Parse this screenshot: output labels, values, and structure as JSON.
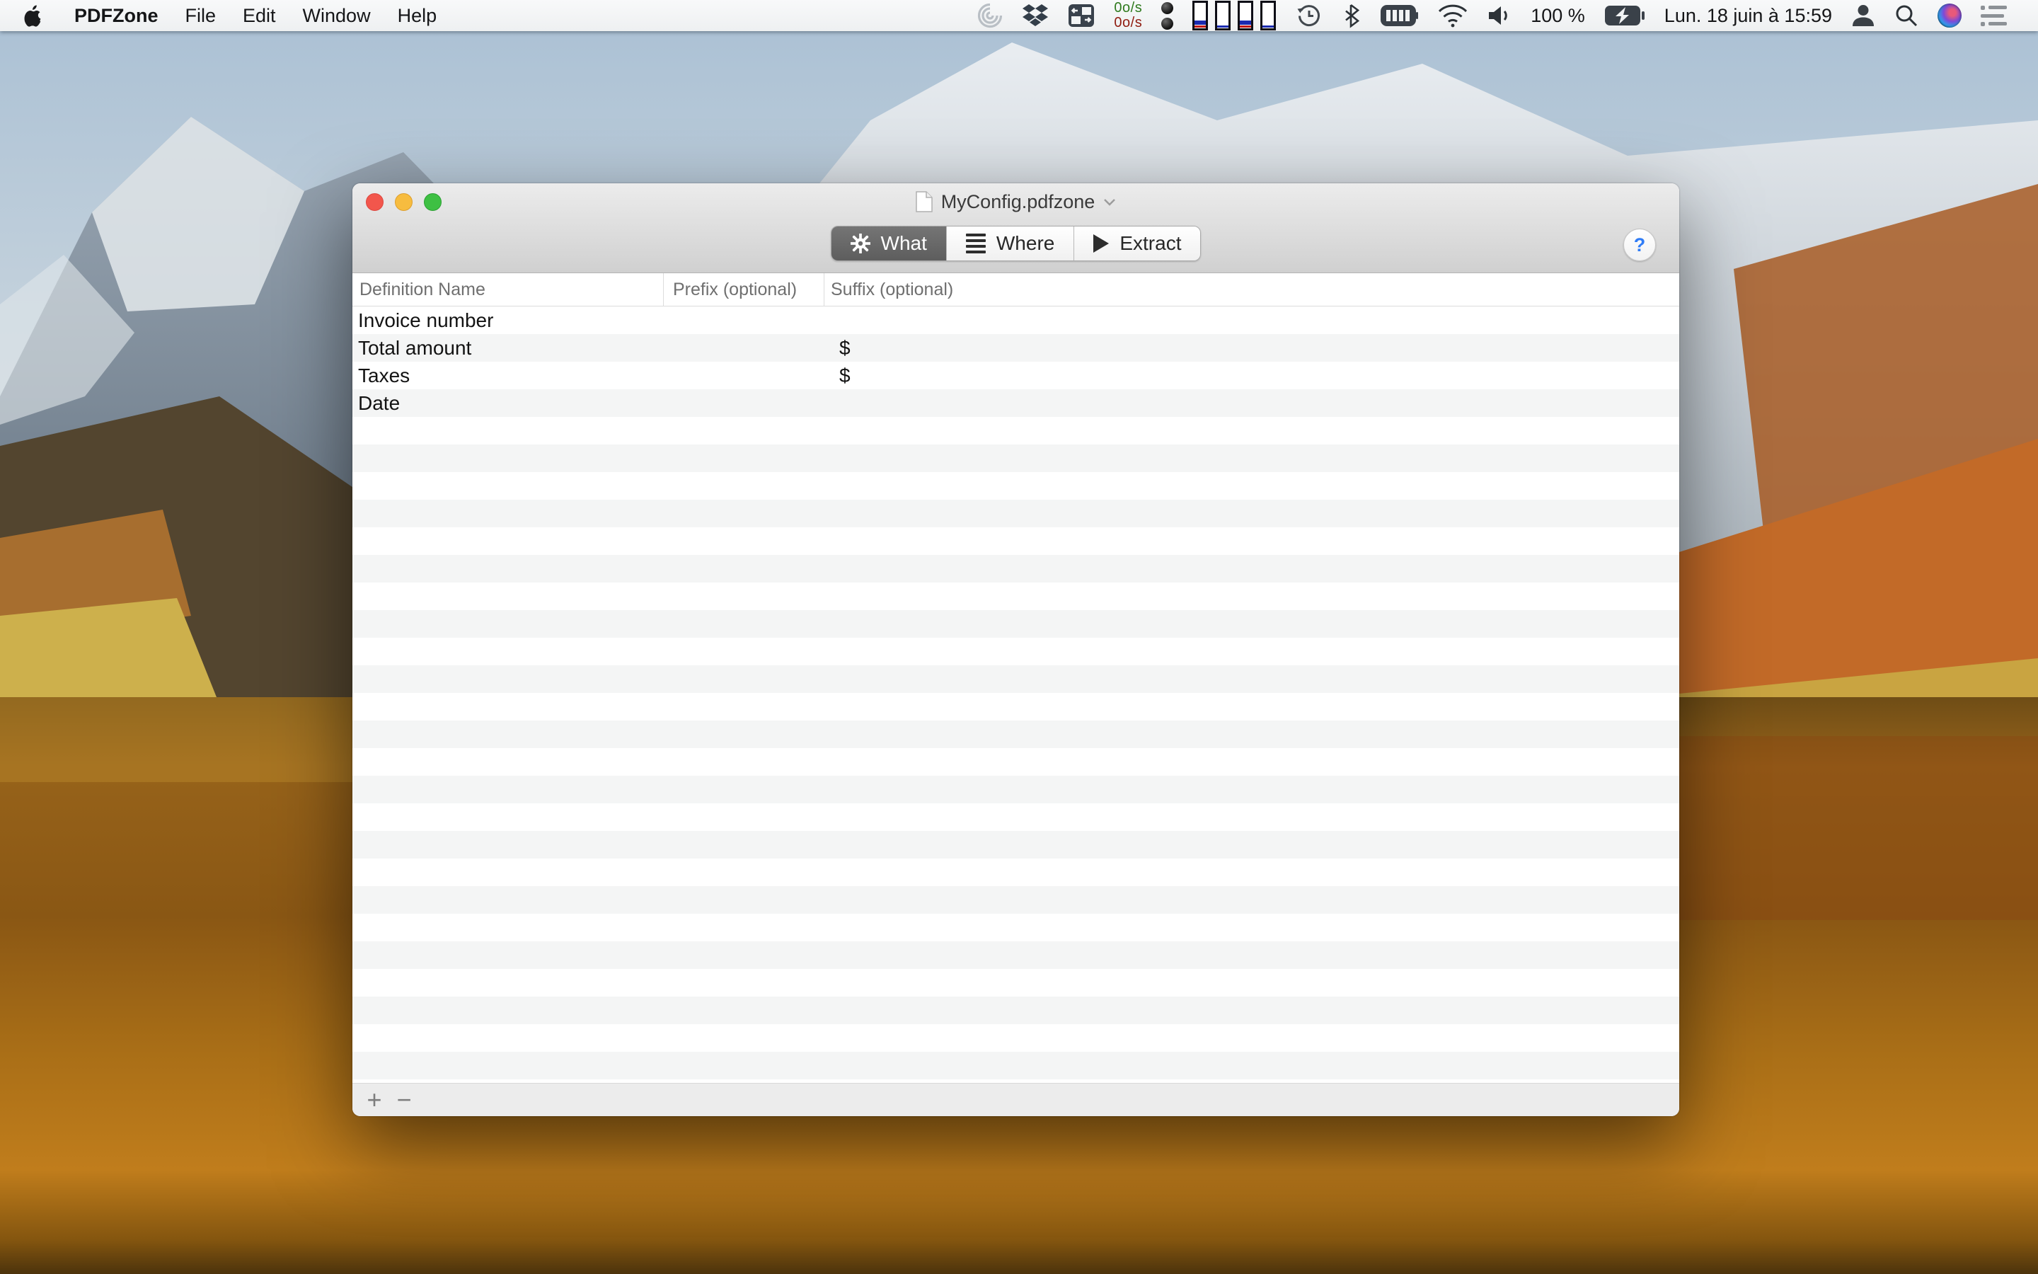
{
  "menu_bar": {
    "app_menus": [
      "PDFZone",
      "File",
      "Edit",
      "Window",
      "Help"
    ],
    "network": {
      "down": "0o/s",
      "up": "0o/s"
    },
    "battery_percent": "100 %",
    "clock": "Lun. 18 juin à 15:59"
  },
  "window": {
    "title": "MyConfig.pdfzone",
    "toolbar": {
      "tabs": [
        {
          "label": "What",
          "icon": "gear-icon",
          "selected": true
        },
        {
          "label": "Where",
          "icon": "lines-icon",
          "selected": false
        },
        {
          "label": "Extract",
          "icon": "play-icon",
          "selected": false
        }
      ],
      "help_label": "?"
    },
    "table": {
      "columns": [
        "Definition Name",
        "Prefix (optional)",
        "Suffix (optional)"
      ],
      "rows": [
        {
          "name": "Invoice number",
          "prefix": "",
          "suffix": ""
        },
        {
          "name": "Total amount",
          "prefix": "",
          "suffix": "$"
        },
        {
          "name": "Taxes",
          "prefix": "",
          "suffix": "$"
        },
        {
          "name": "Date",
          "prefix": "",
          "suffix": ""
        }
      ],
      "empty_row_count": 24
    },
    "footer": {
      "add_label": "+",
      "remove_label": "−"
    }
  },
  "colors": {
    "row_stripe": "#f4f5f5",
    "selected_segment": "#696969",
    "help_blue": "#2f7cf6",
    "net_down_green": "#2f7a1e",
    "net_up_red": "#8f1b10",
    "menubar_bg": "#f4f5f6",
    "chrome_top": "#ececec",
    "chrome_bottom": "#d0d0d0"
  }
}
